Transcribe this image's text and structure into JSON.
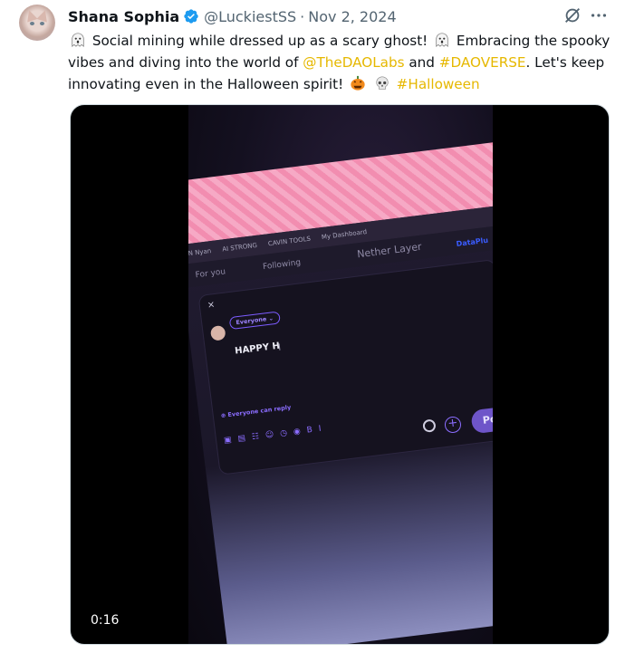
{
  "author": {
    "name": "Shana Sophia",
    "handle": "@LuckiestSS",
    "separator": "·",
    "date": "Nov 2, 2024",
    "verified": true
  },
  "tweet": {
    "line1_a": "Social mining while dressed up as a scary ghost!",
    "line1_b": "Embracing the spooky",
    "line2_a": "vibes and diving into the world of",
    "mention": "@TheDAOLabs",
    "line2_b": "and",
    "hashtag1": "#DAOVERSE",
    "line2_c": ". Let's keep",
    "line3_a": "innovating even in the Halloween spirit!",
    "hashtag2": "#Halloween",
    "emojis": [
      "ghost-emoji",
      "ghost-emoji",
      "jack-o-lantern-emoji",
      "skull-emoji"
    ]
  },
  "video": {
    "duration": "0:16",
    "browser": {
      "bookmarks": [
        "N  Nyan",
        "AI STRONG",
        "CAVIN TOOLS",
        "My Dashboard"
      ],
      "tabs": [
        "For you",
        "Following",
        "Nether Layer"
      ],
      "overflow_link": "DataPlu"
    },
    "composer": {
      "close": "×",
      "audience": "Everyone ⌄",
      "text": "HAPPY H",
      "caret": "I",
      "reply_setting": "⊕ Everyone can reply",
      "toolbar_icons": "▣▤☷☺◷◉BI",
      "plus": "+",
      "post_label": "Post"
    }
  },
  "colors": {
    "link": "#e6b800",
    "verified": "#1d9bf0",
    "secondary_text": "#536471"
  }
}
